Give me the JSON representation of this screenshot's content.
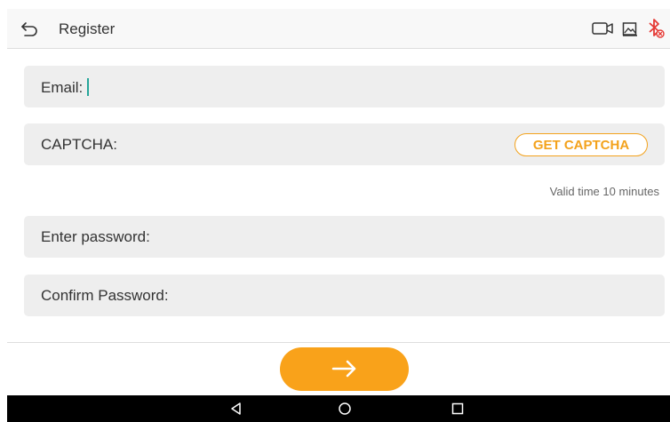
{
  "header": {
    "title": "Register",
    "icons": [
      "back-arrow-icon",
      "video-camera-icon",
      "image-icon",
      "bluetooth-off-icon"
    ]
  },
  "form": {
    "email_label": "Email:",
    "captcha_label": "CAPTCHA:",
    "get_captcha_label": "GET CAPTCHA",
    "valid_time_text": "Valid time 10 minutes",
    "password_label": "Enter password:",
    "confirm_password_label": "Confirm Password:"
  },
  "actions": {
    "next_icon": "arrow-right-icon"
  },
  "navbar": {
    "icons": [
      "nav-back-icon",
      "nav-home-icon",
      "nav-recents-icon"
    ]
  },
  "colors": {
    "accent": "#f9a21a",
    "caret": "#26a69a",
    "bluetooth_off": "#e53935",
    "field_bg": "#eeeeee"
  }
}
